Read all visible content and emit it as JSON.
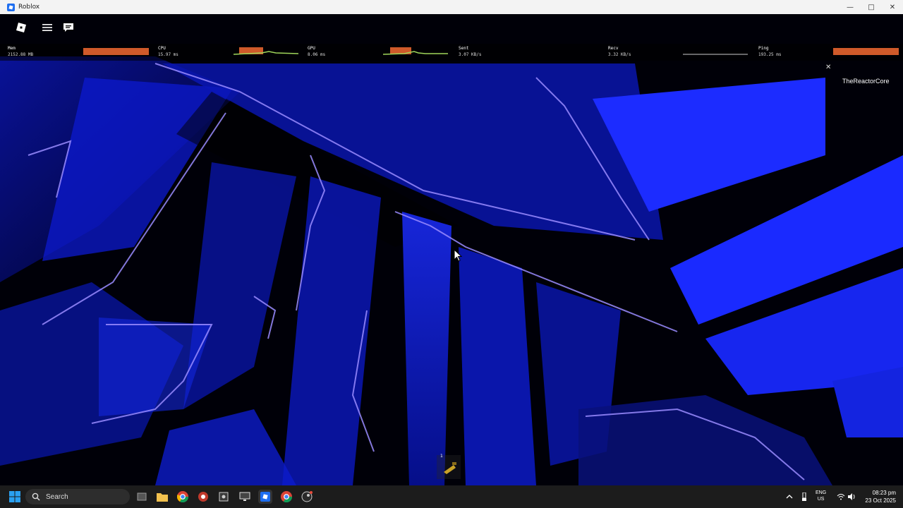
{
  "window": {
    "title": "Roblox"
  },
  "stats": [
    {
      "label": "Mem",
      "value": "2152.88 MB"
    },
    {
      "label": "CPU",
      "value": "15.97 ms"
    },
    {
      "label": "GPU",
      "value": "8.06 ms"
    },
    {
      "label": "Sent",
      "value": "3.07 KB/s"
    },
    {
      "label": "Recv",
      "value": "3.32 KB/s"
    },
    {
      "label": "Ping",
      "value": "193.25 ms"
    }
  ],
  "notification": {
    "player_name": "TheReactorCore"
  },
  "hotbar": {
    "slot_number": "1"
  },
  "taskbar": {
    "search_label": "Search",
    "lang_line1": "ENG",
    "lang_line2": "US",
    "time": "08:23 pm",
    "date": "23 Oct 2025"
  },
  "colors": {
    "accent": "#1e6ef0",
    "stat_bar": "#cf5a2a",
    "scene_blue": "#1a2cff"
  }
}
